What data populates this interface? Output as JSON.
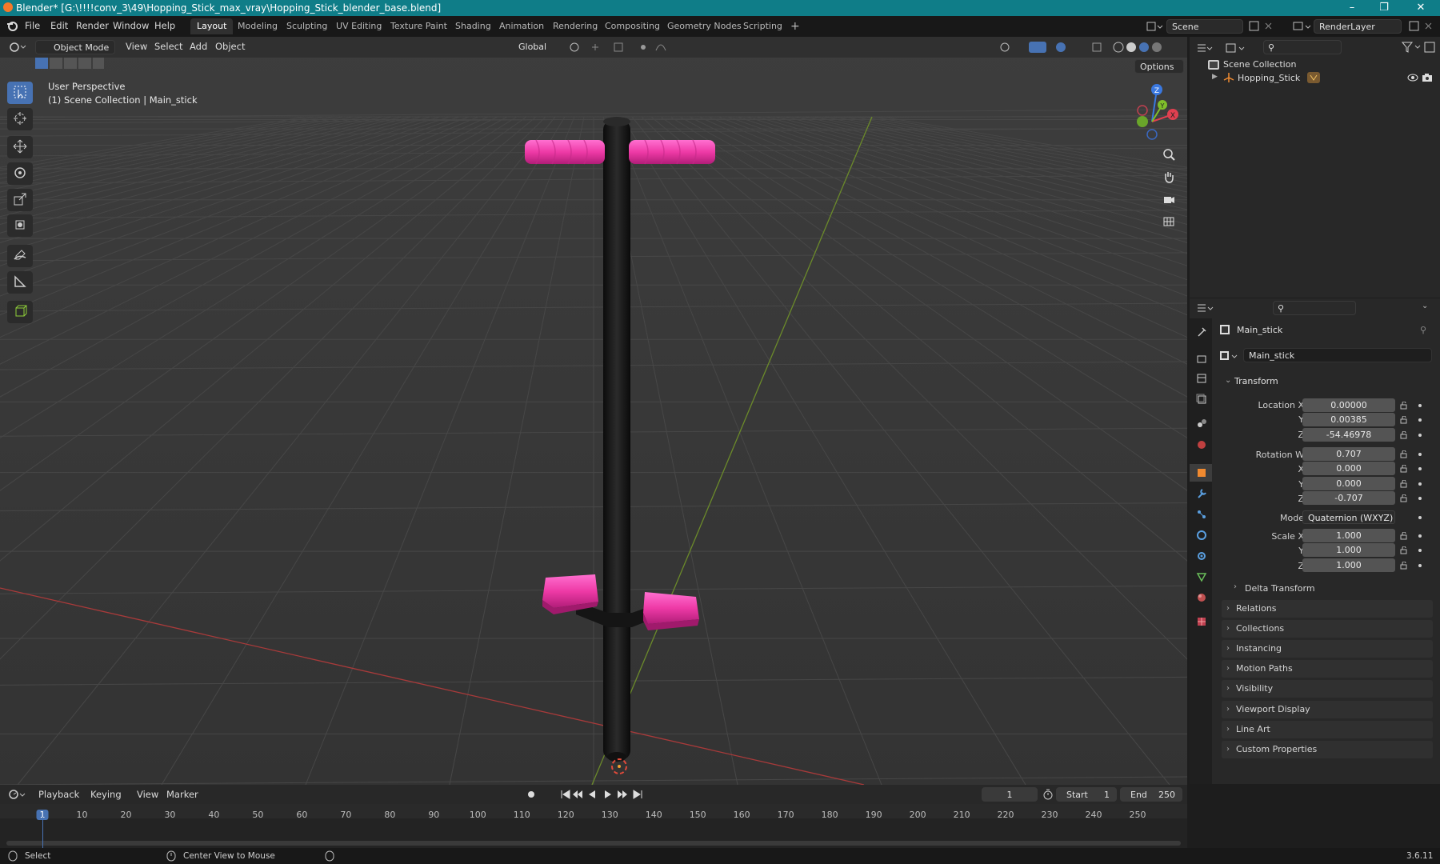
{
  "title_bar": {
    "title": "Blender* [G:\\!!!!conv_3\\49\\Hopping_Stick_max_vray\\Hopping_Stick_blender_base.blend]"
  },
  "menu": [
    "File",
    "Edit",
    "Render",
    "Window",
    "Help"
  ],
  "workspaces": [
    "Layout",
    "Modeling",
    "Sculpting",
    "UV Editing",
    "Texture Paint",
    "Shading",
    "Animation",
    "Rendering",
    "Compositing",
    "Geometry Nodes",
    "Scripting"
  ],
  "scene": {
    "scene_name": "Scene",
    "view_layer": "RenderLayer"
  },
  "viewport_header": {
    "mode": "Object Mode",
    "menus": [
      "View",
      "Select",
      "Add",
      "Object"
    ],
    "orientation": "Global",
    "options": "Options"
  },
  "viewport_overlay": {
    "view_name": "User Perspective",
    "collection_info": "(1) Scene Collection | Main_stick"
  },
  "gizmo": {
    "x": "X",
    "y": "Y",
    "z": "Z"
  },
  "outliner": {
    "root": "Scene Collection",
    "items": [
      {
        "label": "Hopping_Stick"
      }
    ]
  },
  "properties": {
    "object_name": "Main_stick",
    "datablock_name": "Main_stick",
    "transform_label": "Transform",
    "location": {
      "label_x": "Location X",
      "label_y": "Y",
      "label_z": "Z",
      "x": "0.00000",
      "y": "0.00385",
      "z": "-54.46978"
    },
    "rotation": {
      "label_w": "Rotation W",
      "label_x": "X",
      "label_y": "Y",
      "label_z": "Z",
      "w": "0.707",
      "x": "0.000",
      "y": "0.000",
      "z": "-0.707"
    },
    "mode": {
      "label": "Mode",
      "value": "Quaternion (WXYZ)"
    },
    "scale": {
      "label_x": "Scale X",
      "label_y": "Y",
      "label_z": "Z",
      "x": "1.000",
      "y": "1.000",
      "z": "1.000"
    },
    "delta_transform": "Delta Transform",
    "panels": [
      "Relations",
      "Collections",
      "Instancing",
      "Motion Paths",
      "Visibility",
      "Viewport Display",
      "Line Art",
      "Custom Properties"
    ]
  },
  "timeline": {
    "menus": [
      "Playback",
      "Keying",
      "View",
      "Marker"
    ],
    "current_frame": "1",
    "start_label": "Start",
    "start": "1",
    "end_label": "End",
    "end": "250",
    "ticks": [
      "1",
      "10",
      "20",
      "30",
      "40",
      "50",
      "60",
      "70",
      "80",
      "90",
      "100",
      "110",
      "120",
      "130",
      "140",
      "150",
      "160",
      "170",
      "180",
      "190",
      "200",
      "210",
      "220",
      "230",
      "240",
      "250"
    ]
  },
  "status_bar": {
    "left": "Select",
    "middle": "Center View to Mouse",
    "version": "3.6.11"
  },
  "colors": {
    "accent": "#4772b3",
    "title_bar": "#0f7d88",
    "object_pink": "#ee3aa6"
  }
}
